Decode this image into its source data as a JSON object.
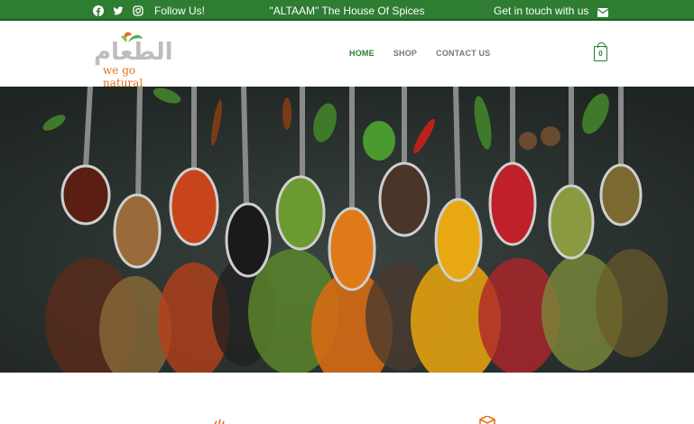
{
  "topbar": {
    "follow_label": "Follow Us!",
    "tagline": "\"ALTAAM\" The House Of Spices",
    "contact_label": "Get in touch with us",
    "social_icons": [
      "facebook-icon",
      "twitter-icon",
      "instagram-icon"
    ],
    "mail_icon": "envelope-icon",
    "background_color": "#2e7d32"
  },
  "header": {
    "logo_arabic": "الطعام",
    "logo_sub": "we go natural",
    "nav": {
      "home": "HOME",
      "shop": "SHOP",
      "contact": "CONTACT US"
    },
    "cart_count": "0",
    "accent_color": "#2e7d32"
  },
  "hero": {
    "image": "spoons of assorted spices on dark background"
  },
  "features": {
    "icons": [
      "leaf-icon",
      "box-icon"
    ]
  }
}
